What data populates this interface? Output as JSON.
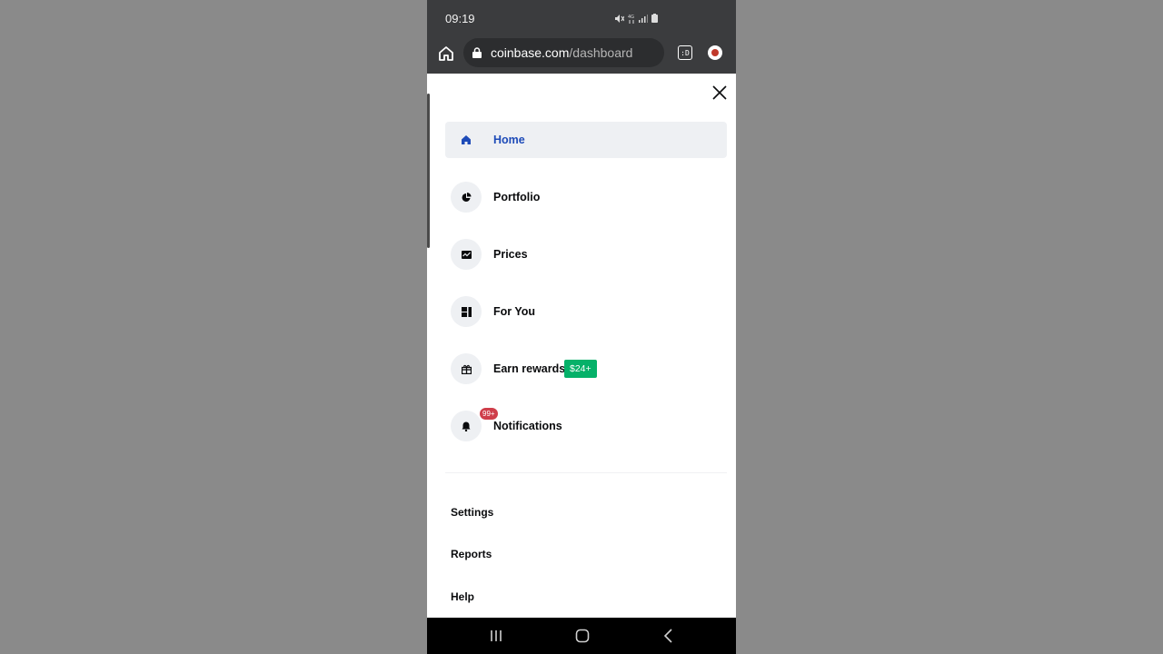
{
  "status_bar": {
    "time": "09:19"
  },
  "browser": {
    "url_domain": "coinbase.com",
    "url_path": "/dashboard",
    "tabs_count": ":D"
  },
  "menu": {
    "items": [
      {
        "label": "Home",
        "icon": "home-icon",
        "active": true
      },
      {
        "label": "Portfolio",
        "icon": "pie-chart-icon",
        "active": false
      },
      {
        "label": "Prices",
        "icon": "chart-icon",
        "active": false
      },
      {
        "label": "For You",
        "icon": "layout-icon",
        "active": false
      },
      {
        "label": "Earn rewards",
        "icon": "gift-icon",
        "active": false,
        "badge": "$24+"
      },
      {
        "label": "Notifications",
        "icon": "bell-icon",
        "active": false,
        "badge": "99+"
      }
    ],
    "secondary": [
      {
        "label": "Settings"
      },
      {
        "label": "Reports"
      },
      {
        "label": "Help"
      }
    ]
  },
  "colors": {
    "accent": "#1e4bb8",
    "reward_badge": "#05b169",
    "notification_badge": "#cf3e4a",
    "browser_chrome": "#3b3c3e"
  }
}
